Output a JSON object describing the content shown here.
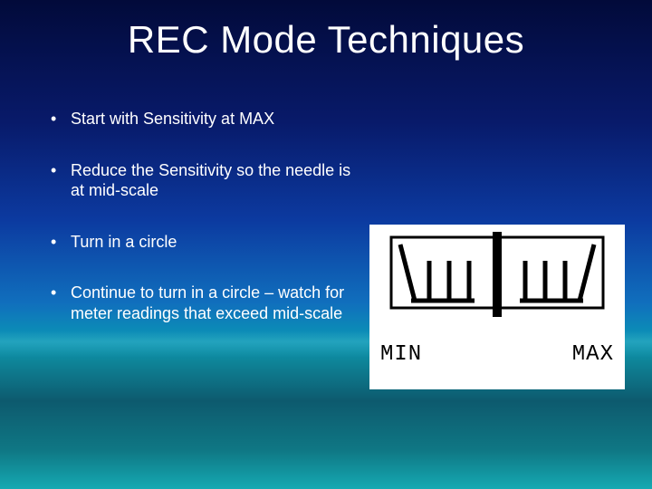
{
  "title": "REC Mode Techniques",
  "bullets": [
    "Start with Sensitivity at MAX",
    "Reduce the Sensitivity so the needle is at mid-scale",
    "Turn in a circle",
    "Continue to turn in a circle – watch for meter readings that exceed mid-scale"
  ],
  "meter": {
    "min_label": "MIN",
    "max_label": "MAX"
  }
}
